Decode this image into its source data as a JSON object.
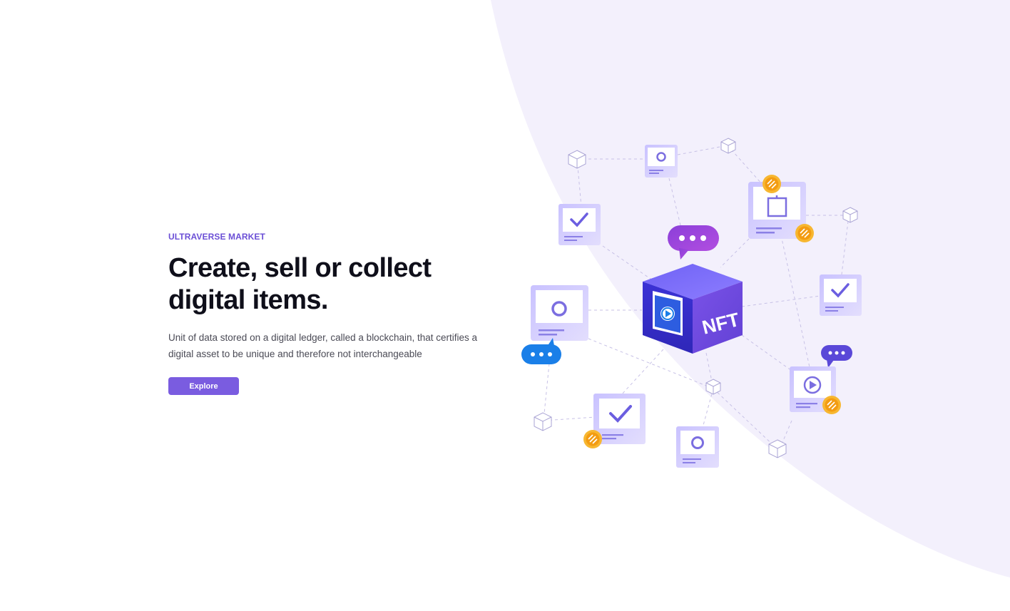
{
  "hero": {
    "eyebrow": "ULTRAVERSE MARKET",
    "headline_line1": "Create, sell or collect",
    "headline_line2": "digital items.",
    "description": "Unit of data stored on a digital ledger, called a blockchain, that certifies a digital asset to be unique and therefore not interchangeable",
    "cta_label": "Explore"
  },
  "illustration": {
    "badge_text": "NFT"
  },
  "colors": {
    "accent": "#7a5ce0",
    "eyebrow": "#6b4fd6",
    "headline": "#0f0f1a",
    "body_text": "#4a4a55",
    "background_shape": "#f3f0fc",
    "cube_front": "#4a3fe0",
    "chat_blue": "#1a7fe8",
    "chat_purple": "#9a3fd9",
    "coin": "#f39c12"
  }
}
